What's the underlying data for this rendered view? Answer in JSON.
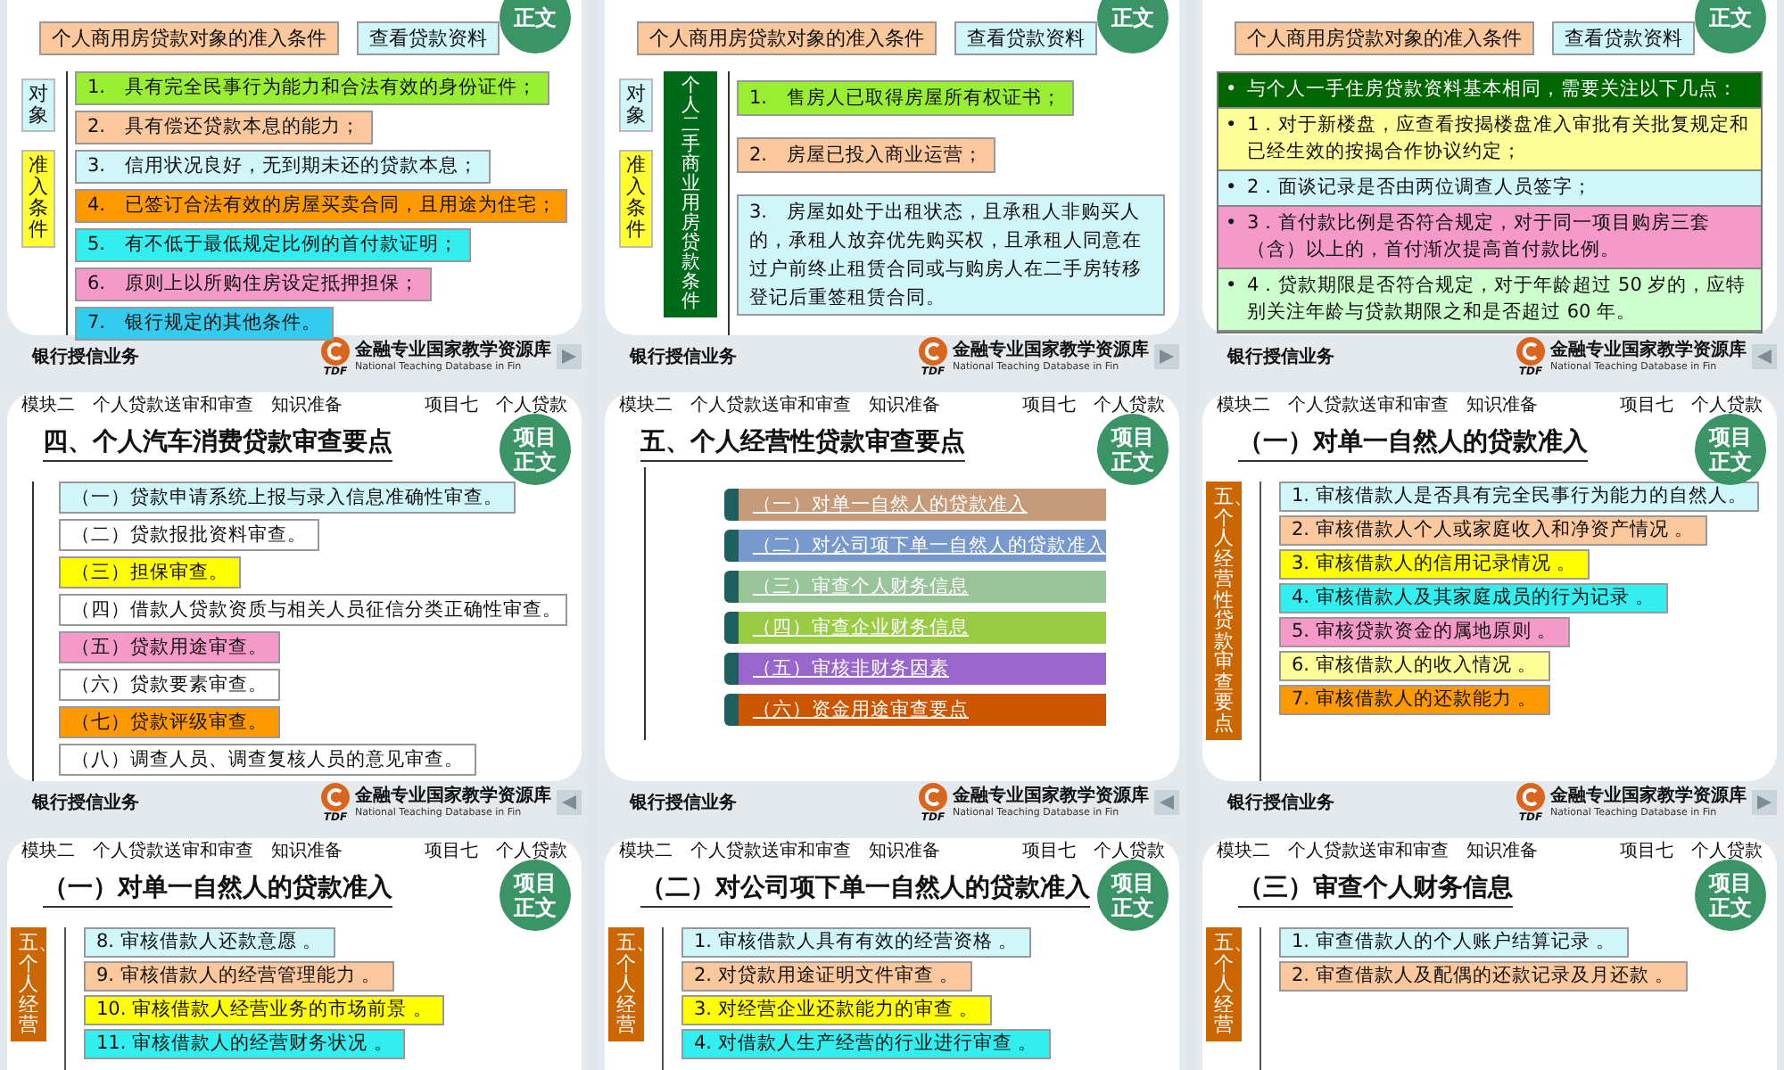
{
  "slides": [
    {
      "kind": "criteria",
      "badge": [
        "正文"
      ],
      "top_boxes": [
        {
          "text": "个人商用房贷款对象的准入条件",
          "color": "#fac89c"
        },
        {
          "text": "查看贷款资料",
          "color": "#d0f6fa"
        }
      ],
      "labels": [
        {
          "text": "对象",
          "color": "#d0f6fa"
        },
        {
          "text": "准入条件",
          "color": "#ffff33"
        }
      ],
      "items": [
        {
          "text": "1.　具有完全民事行为能力和合法有效的身份证件；",
          "color": "#99ee33"
        },
        {
          "text": "2.　具有偿还贷款本息的能力；",
          "color": "#fac89c"
        },
        {
          "text": "3.　信用状况良好，无到期未还的贷款本息；",
          "color": "#d0f6fa"
        },
        {
          "text": "4.　已签订合法有效的房屋买卖合同，且用途为住宅；",
          "color": "#ff9900"
        },
        {
          "text": "5.　有不低于最低规定比例的首付款证明；",
          "color": "#33eeee"
        },
        {
          "text": "6.　原则上以所购住房设定抵押担保；",
          "color": "#f59ac8"
        },
        {
          "text": "7.　银行规定的其他条件。",
          "color": "#33ccee"
        }
      ],
      "footer": "银行授信业务",
      "logo_cn": "金融专业国家教学资源库",
      "logo_en": "National Teaching Database in Fin",
      "logo_mark": "TDF",
      "nav_back": false
    },
    {
      "kind": "criteria",
      "badge": [
        "正文"
      ],
      "top_boxes": [
        {
          "text": "个人商用房贷款对象的准入条件",
          "color": "#fac89c"
        },
        {
          "text": "查看贷款资料",
          "color": "#d0f6fa"
        }
      ],
      "labels": [
        {
          "text": "对象",
          "color": "#d0f6fa"
        },
        {
          "text": "准入条件",
          "color": "#ffff33"
        }
      ],
      "side_bar": {
        "text": "个人二手商业用房贷款条件",
        "color": "#006a1a"
      },
      "items": [
        {
          "text": "1.　售房人已取得房屋所有权证书；",
          "color": "#99ee33"
        },
        {
          "text": "2.　房屋已投入商业运营；",
          "color": "#fac89c"
        },
        {
          "text": "3.　房屋如处于出租状态，且承租人非购买人的，承租人放弃优先购买权，且承租人同意在过户前终止租赁合同或与购房人在二手房转移登记后重签租赁合同。",
          "color": "#d0f6fa"
        }
      ],
      "footer": "银行授信业务",
      "logo_cn": "金融专业国家教学资源库",
      "logo_en": "National Teaching Database in Fin",
      "logo_mark": "TDF",
      "nav_back": false
    },
    {
      "kind": "bullets",
      "badge": [
        "正文"
      ],
      "top_boxes": [
        {
          "text": "个人商用房贷款对象的准入条件",
          "color": "#fac89c"
        },
        {
          "text": "查看贷款资料",
          "color": "#d0f6fa"
        }
      ],
      "items": [
        {
          "marker": "•",
          "text": "与个人一手住房贷款资料基本相同，需要关注以下几点：",
          "color": "#006600"
        },
        {
          "marker": "•",
          "text": "1．对于新楼盘，应查看按揭楼盘准入审批有关批复规定和已经生效的按揭合作协议约定；",
          "color": "#ffff99"
        },
        {
          "marker": "•",
          "text": "2．面谈记录是否由两位调查人员签字；",
          "color": "#d0f6fa"
        },
        {
          "marker": "•",
          "text": "3．首付款比例是否符合规定，对于同一项目购房三套（含）以上的，首付渐次提高首付款比例。",
          "color": "#f59ac8"
        },
        {
          "marker": "•",
          "text": "4．贷款期限是否符合规定，对于年龄超过 50 岁的，应特别关注年龄与贷款期限之和是否超过 60 年。",
          "color": "#ccffcc"
        }
      ],
      "footer": "银行授信业务",
      "logo_cn": "金融专业国家教学资源库",
      "logo_en": "National Teaching Database in Fin",
      "logo_mark": "TDF",
      "nav_back": true
    },
    {
      "kind": "outline",
      "header_left": "模块二　个人贷款送审和审查　知识准备",
      "header_right": "项目七　个人贷款",
      "title": "四、个人汽车消费贷款审查要点",
      "badge": [
        "项目",
        "正文"
      ],
      "items": [
        {
          "text": "（一）贷款申请系统上报与录入信息准确性审查。",
          "color": "#d0f6fa"
        },
        {
          "text": "（二）贷款报批资料审查。",
          "color": "#ffffff"
        },
        {
          "text": "（三）担保审查。",
          "color": "#ffff00"
        },
        {
          "text": "（四）借款人贷款资质与相关人员征信分类正确性审查。",
          "color": "#ffffff"
        },
        {
          "text": "（五）贷款用途审查。",
          "color": "#f59ac8"
        },
        {
          "text": "（六）贷款要素审查。",
          "color": "#ffffff"
        },
        {
          "text": "（七）贷款评级审查。",
          "color": "#ff9900"
        },
        {
          "text": "（八）调查人员、调查复核人员的意见审查。",
          "color": "#ffffff"
        }
      ],
      "footer": "银行授信业务",
      "logo_cn": "金融专业国家教学资源库",
      "logo_en": "National Teaching Database in Fin",
      "logo_mark": "TDF",
      "nav_back": true
    },
    {
      "kind": "links",
      "header_left": "模块二　个人贷款送审和审查　知识准备",
      "header_right": "项目七　个人贷款",
      "title": "五、个人经营性贷款审查要点",
      "badge": [
        "项目",
        "正文"
      ],
      "items": [
        {
          "text": "（一）对单一自然人的贷款准入",
          "color": "#c49a78"
        },
        {
          "text": "（二）对公司项下单一自然人的贷款准入",
          "color": "#7799cc"
        },
        {
          "text": "（三）审查个人财务信息",
          "color": "#99c399"
        },
        {
          "text": "（四）审查企业财务信息",
          "color": "#99cc44"
        },
        {
          "text": "（五）审核非财务因素",
          "color": "#9966cc"
        },
        {
          "text": "（六）资金用途审查要点",
          "color": "#cc5500"
        }
      ],
      "footer": "银行授信业务",
      "logo_cn": "金融专业国家教学资源库",
      "logo_en": "National Teaching Database in Fin",
      "logo_mark": "TDF",
      "nav_back": true
    },
    {
      "kind": "side",
      "header_left": "模块二　个人贷款送审和审查　知识准备",
      "header_right": "项目七　个人贷款",
      "title": "（一）对单一自然人的贷款准入",
      "badge": [
        "项目",
        "正文"
      ],
      "side_bar": {
        "text": "五、个人经营性贷款审查要点",
        "color": "#cc6600"
      },
      "items": [
        {
          "text": "1. 审核借款人是否具有完全民事行为能力的自然人。",
          "color": "#d0f6fa"
        },
        {
          "text": "2. 审核借款人个人或家庭收入和净资产情况 。",
          "color": "#fac89c"
        },
        {
          "text": "3. 审核借款人的信用记录情况 。",
          "color": "#ffff00"
        },
        {
          "text": "4. 审核借款人及其家庭成员的行为记录 。",
          "color": "#33eeee"
        },
        {
          "text": "5. 审核贷款资金的属地原则 。",
          "color": "#f59ac8"
        },
        {
          "text": "6. 审核借款人的收入情况 。",
          "color": "#ffff99"
        },
        {
          "text": "7. 审核借款人的还款能力 。",
          "color": "#ff9900"
        }
      ],
      "footer": "银行授信业务",
      "logo_cn": "金融专业国家教学资源库",
      "logo_en": "National Teaching Database in Fin",
      "logo_mark": "TDF",
      "nav_back": false
    },
    {
      "kind": "side",
      "header_left": "模块二　个人贷款送审和审查　知识准备",
      "header_right": "项目七　个人贷款",
      "title": "（一）对单一自然人的贷款准入",
      "badge": [
        "项目",
        "正文"
      ],
      "side_bar": {
        "text": "五、个人经营",
        "color": "#cc6600"
      },
      "items": [
        {
          "text": "8. 审核借款人还款意愿 。",
          "color": "#d0f6fa"
        },
        {
          "text": "9. 审核借款人的经营管理能力 。",
          "color": "#fac89c"
        },
        {
          "text": "10. 审核借款人经营业务的市场前景 。",
          "color": "#ffff00"
        },
        {
          "text": "11. 审核借款人的经营财务状况 。",
          "color": "#33eeee"
        }
      ]
    },
    {
      "kind": "side",
      "header_left": "模块二　个人贷款送审和审查　知识准备",
      "header_right": "项目七　个人贷款",
      "title": "（二）对公司项下单一自然人的贷款准入",
      "badge": [
        "项目",
        "正文"
      ],
      "side_bar": {
        "text": "五、个人经营",
        "color": "#cc6600"
      },
      "items": [
        {
          "text": "1. 审核借款人具有有效的经营资格 。",
          "color": "#d0f6fa"
        },
        {
          "text": "2. 对贷款用途证明文件审查 。",
          "color": "#fac89c"
        },
        {
          "text": "3. 对经营企业还款能力的审查 。",
          "color": "#ffff00"
        },
        {
          "text": "4. 对借款人生产经营的行业进行审查 。",
          "color": "#33eeee"
        }
      ]
    },
    {
      "kind": "side",
      "header_left": "模块二　个人贷款送审和审查　知识准备",
      "header_right": "项目七　个人贷款",
      "title": "（三）审查个人财务信息",
      "badge": [
        "项目",
        "正文"
      ],
      "side_bar": {
        "text": "五、个人经营",
        "color": "#cc6600"
      },
      "items": [
        {
          "text": "1. 审查借款人的个人账户结算记录 。",
          "color": "#d0f6fa"
        },
        {
          "text": "2. 审查借款人及配偶的还款记录及月还款 。",
          "color": "#fac89c"
        }
      ]
    }
  ]
}
